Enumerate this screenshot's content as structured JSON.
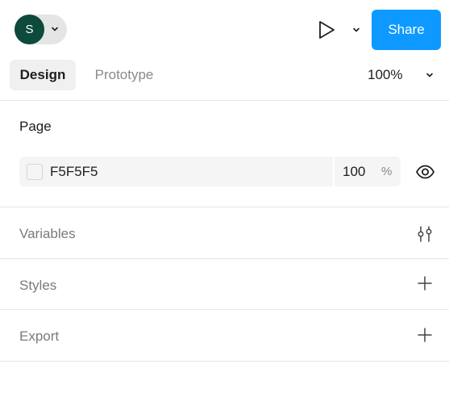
{
  "header": {
    "avatar_initial": "S",
    "share_label": "Share"
  },
  "tabs": {
    "design": "Design",
    "prototype": "Prototype",
    "zoom": "100%"
  },
  "page": {
    "title": "Page",
    "fill_hex": "F5F5F5",
    "opacity": "100",
    "opacity_unit": "%"
  },
  "sections": {
    "variables": "Variables",
    "styles": "Styles",
    "export": "Export"
  },
  "colors": {
    "accent": "#0d99ff",
    "avatar_bg": "#0d4a3b",
    "page_fill": "#F5F5F5"
  },
  "icons": {
    "avatar_menu": "chevron-down-icon",
    "play": "play-icon",
    "play_menu": "chevron-down-icon",
    "zoom_menu": "chevron-down-icon",
    "visibility": "eye-icon",
    "variables": "sliders-icon",
    "styles_add": "plus-icon",
    "export_add": "plus-icon"
  }
}
